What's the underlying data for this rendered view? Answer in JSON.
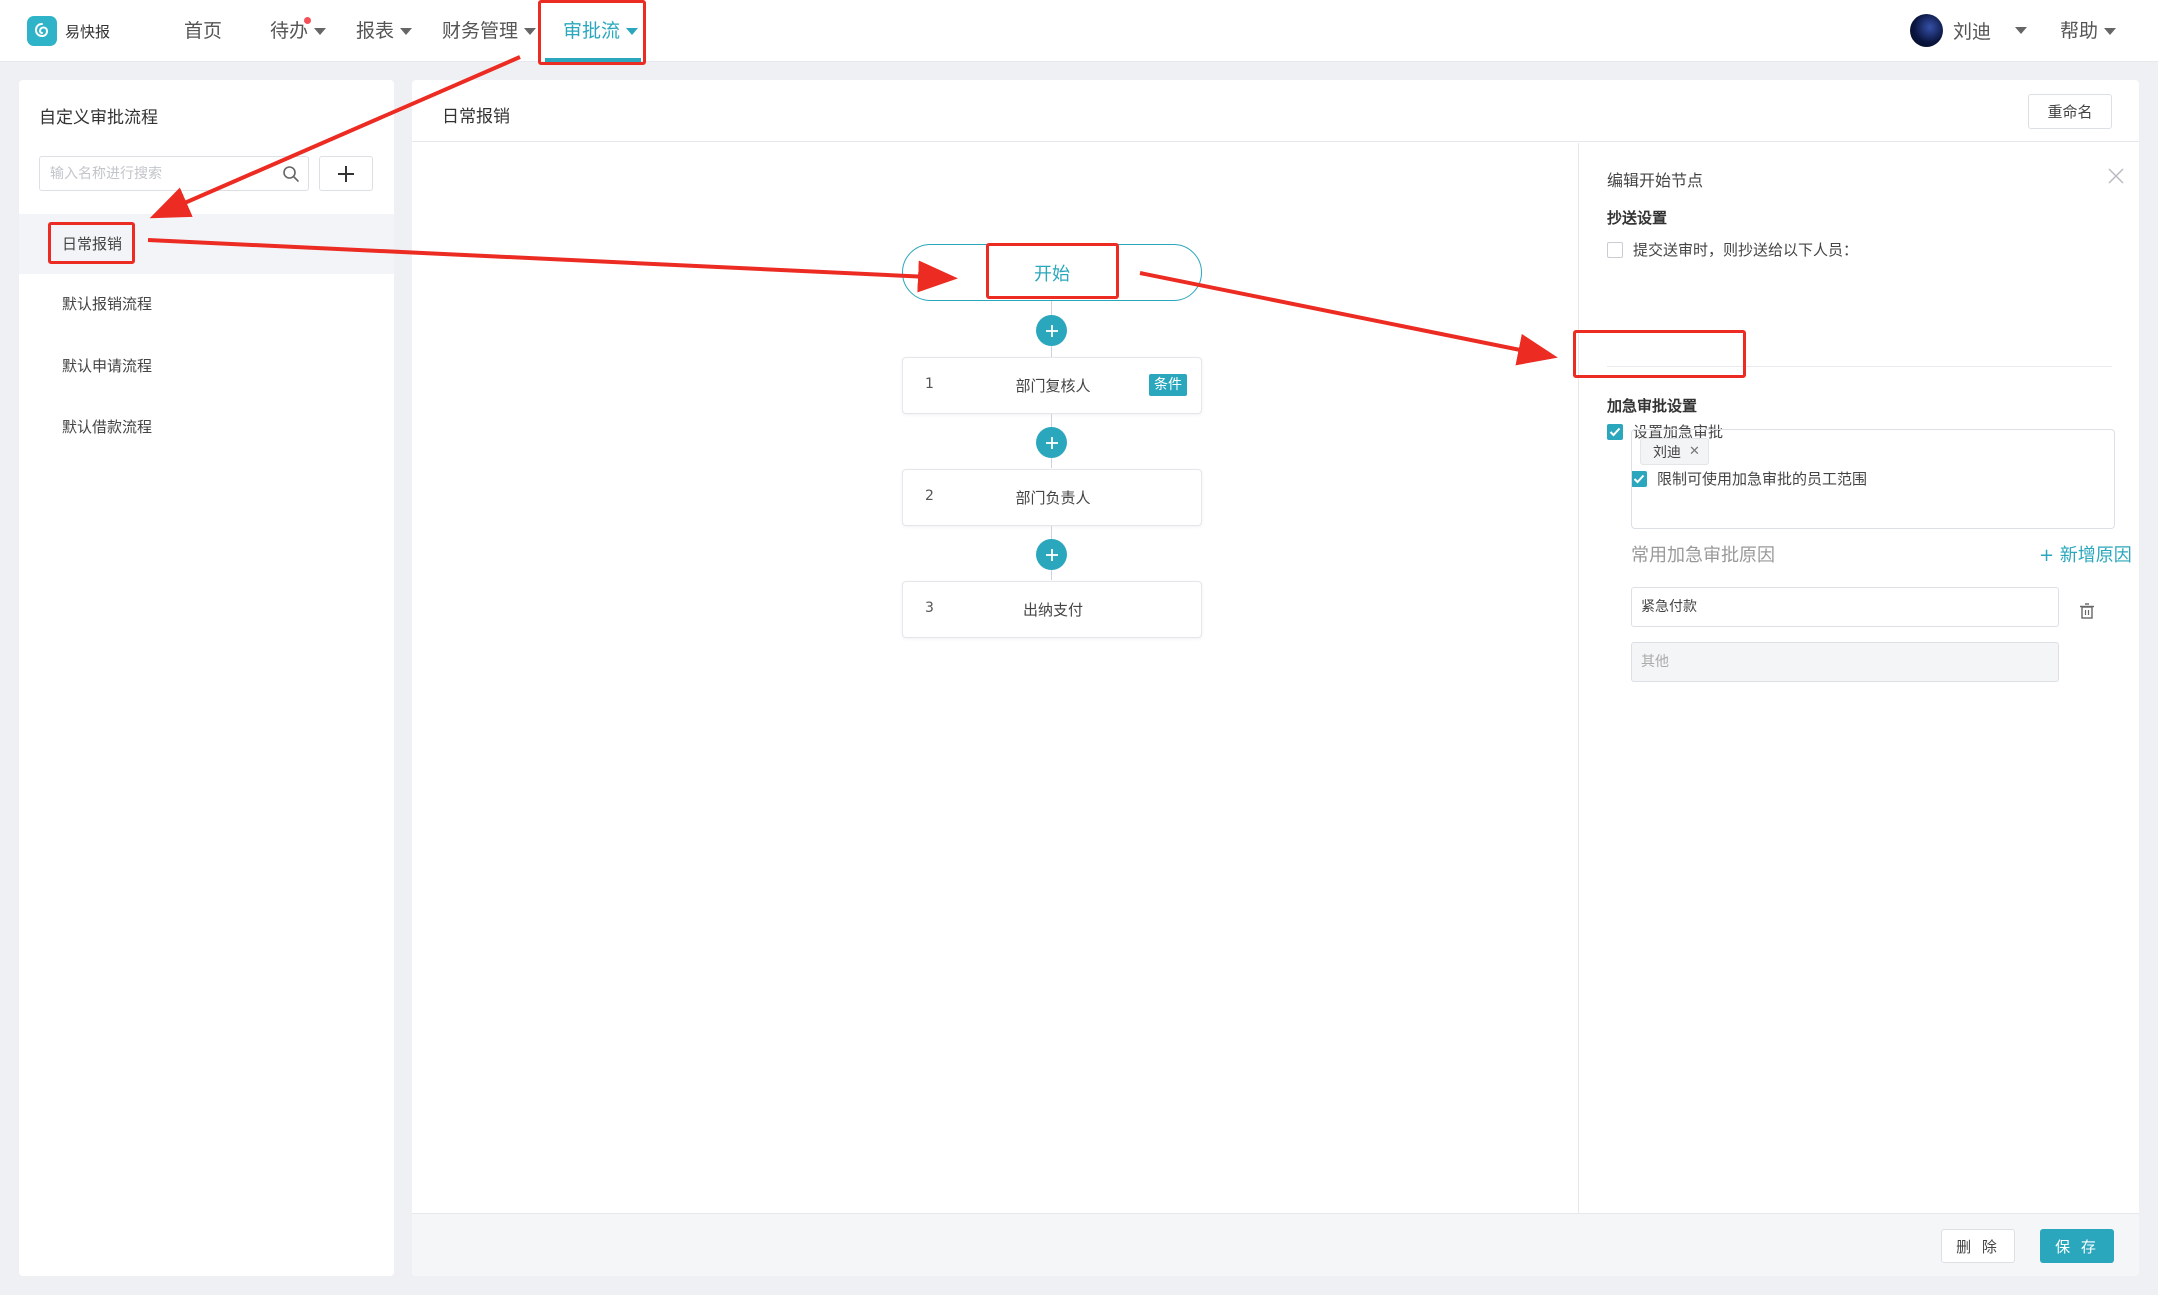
{
  "app": {
    "logo_text": "易快报"
  },
  "nav": {
    "items": [
      {
        "label": "首页",
        "has_caret": false
      },
      {
        "label": "待办",
        "has_caret": true,
        "badge": true
      },
      {
        "label": "报表",
        "has_caret": true
      },
      {
        "label": "财务管理",
        "has_caret": true
      },
      {
        "label": "审批流",
        "has_caret": true,
        "active": true
      }
    ],
    "user_name": "刘迪",
    "help_label": "帮助"
  },
  "sidebar": {
    "title": "自定义审批流程",
    "search_placeholder": "输入名称进行搜索",
    "items": [
      {
        "label": "日常报销",
        "selected": true
      },
      {
        "label": "默认报销流程"
      },
      {
        "label": "默认申请流程"
      },
      {
        "label": "默认借款流程"
      }
    ]
  },
  "main": {
    "title": "日常报销",
    "rename_label": "重命名",
    "flow": {
      "start_label": "开始",
      "steps": [
        {
          "no": "1",
          "label": "部门复核人",
          "tag": "条件"
        },
        {
          "no": "2",
          "label": "部门负责人"
        },
        {
          "no": "3",
          "label": "出纳支付"
        }
      ]
    }
  },
  "edit_panel": {
    "title": "编辑开始节点",
    "cc_section_title": "抄送设置",
    "cc_checkbox_label": "提交送审时，则抄送给以下人员：",
    "cc_checked": false,
    "urgent_section_title": "加急审批设置",
    "urgent_checkbox_label": "设置加急审批",
    "urgent_checked": true,
    "limit_checkbox_label": "限制可使用加急审批的员工范围",
    "limit_checked": true,
    "scope_tags": [
      "刘迪"
    ],
    "reasons_title": "常用加急审批原因",
    "add_reason_label": "+ 新增原因",
    "reasons": [
      {
        "value": "紧急付款",
        "disabled": false
      },
      {
        "value": "其他",
        "disabled": true
      }
    ]
  },
  "footer": {
    "delete_label": "删 除",
    "save_label": "保 存"
  },
  "colors": {
    "accent": "#2aa7bd",
    "annotation": "#ec2b22"
  }
}
